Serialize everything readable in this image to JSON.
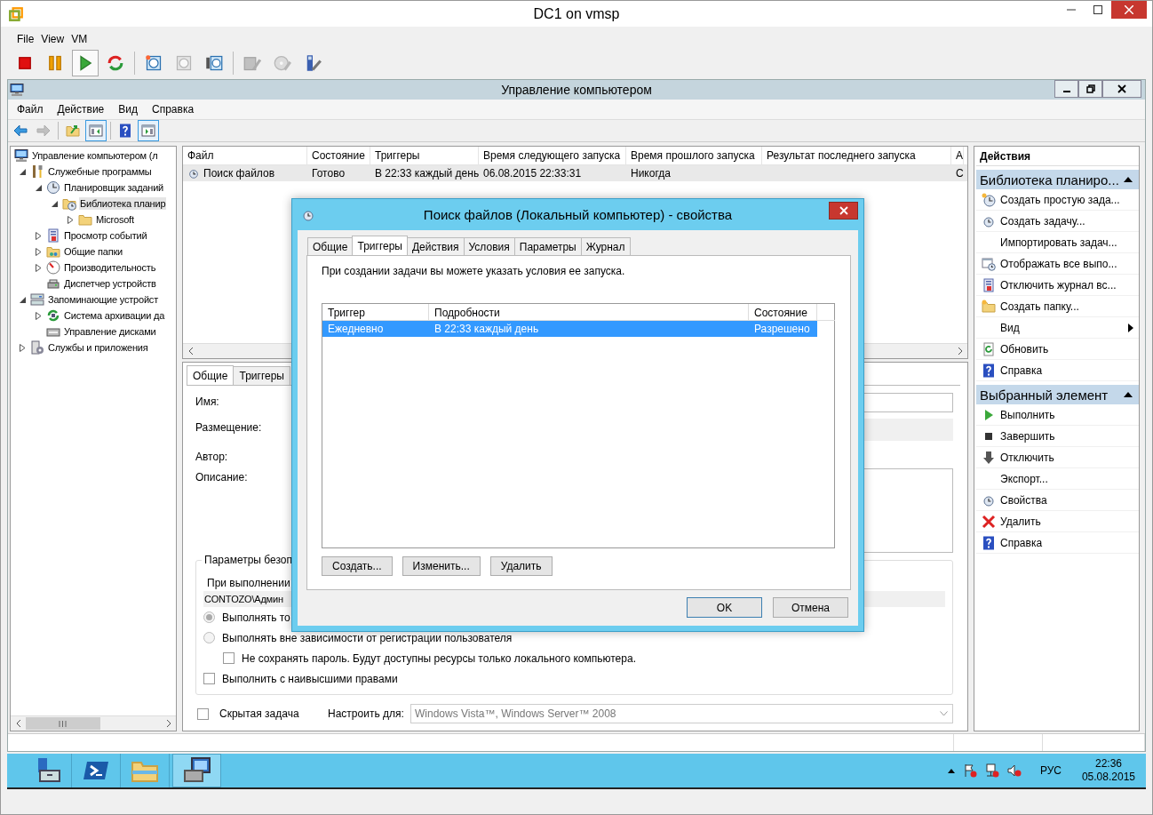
{
  "vm_window": {
    "title": "DC1 on vmsp",
    "menu": [
      "File",
      "View",
      "VM"
    ],
    "toolbar": [
      [
        {
          "kind": "stop",
          "pressed": false,
          "disabled": false
        },
        {
          "kind": "pause",
          "pressed": false,
          "disabled": false
        },
        {
          "kind": "play",
          "pressed": true,
          "disabled": false
        },
        {
          "kind": "reset",
          "pressed": false,
          "disabled": false
        }
      ],
      [
        {
          "kind": "snapshot",
          "pressed": false,
          "disabled": false
        },
        {
          "kind": "revert",
          "pressed": false,
          "disabled": true
        },
        {
          "kind": "snapshot-manager",
          "pressed": false,
          "disabled": false
        }
      ],
      [
        {
          "kind": "settings",
          "pressed": false,
          "disabled": true
        },
        {
          "kind": "disc",
          "pressed": false,
          "disabled": true
        },
        {
          "kind": "usb",
          "pressed": false,
          "disabled": false
        }
      ]
    ]
  },
  "mmc": {
    "title": "Управление компьютером",
    "menu": [
      "Файл",
      "Действие",
      "Вид",
      "Справка"
    ],
    "toolbar": [
      [
        {
          "kind": "back",
          "pressed": false,
          "disabled": false
        },
        {
          "kind": "forward",
          "pressed": false,
          "disabled": true
        }
      ],
      [
        {
          "kind": "folder-up",
          "pressed": false,
          "disabled": false
        },
        {
          "kind": "tree-pane",
          "pressed": true,
          "disabled": false
        }
      ],
      [
        {
          "kind": "help",
          "pressed": false,
          "disabled": false
        },
        {
          "kind": "action-pane",
          "pressed": true,
          "disabled": false
        }
      ]
    ]
  },
  "tree": [
    {
      "label": "Управление компьютером (л",
      "kind": "computer",
      "selected": false,
      "children": [
        {
          "label": "Служебные программы",
          "kind": "tools",
          "expanded": true,
          "selected": false,
          "children": [
            {
              "label": "Планировщик заданий",
              "kind": "clock",
              "expanded": true,
              "selected": false,
              "children": [
                {
                  "label": "Библиотека планир",
                  "kind": "folder-clock",
                  "expanded": true,
                  "selected": true,
                  "children": [
                    {
                      "label": "Microsoft",
                      "kind": "folder",
                      "expanded": false,
                      "selected": false
                    }
                  ]
                }
              ]
            },
            {
              "label": "Просмотр событий",
              "kind": "event-log",
              "expanded": false,
              "selected": false
            },
            {
              "label": "Общие папки",
              "kind": "shared-folder",
              "expanded": false,
              "selected": false
            },
            {
              "label": "Производительность",
              "kind": "gauge",
              "expanded": false,
              "selected": false
            },
            {
              "label": "Диспетчер устройств",
              "kind": "device-manager",
              "selected": false
            }
          ]
        },
        {
          "label": "Запоминающие устройст",
          "kind": "storage",
          "expanded": true,
          "selected": false,
          "children": [
            {
              "label": "Система архивации да",
              "kind": "backup",
              "expanded": false,
              "selected": false
            },
            {
              "label": "Управление дисками",
              "kind": "disk",
              "selected": false
            }
          ]
        },
        {
          "label": "Службы и приложения",
          "kind": "services",
          "expanded": false,
          "selected": false
        }
      ]
    }
  ],
  "task_list": {
    "columns": [
      "Файл",
      "Состояние",
      "Триггеры",
      "Время следующего запуска",
      "Время прошлого запуска",
      "Результат последнего запуска",
      "А"
    ],
    "rows": [
      {
        "cells": [
          "Поиск файлов",
          "Готово",
          "В 22:33 каждый день",
          "06.08.2015 22:33:31",
          "Никогда",
          null,
          "С"
        ],
        "selected": true
      }
    ]
  },
  "details": {
    "tabs": [
      {
        "label": "Общие",
        "selected": true
      },
      {
        "label": "Триггеры",
        "selected": false
      }
    ],
    "fields": [
      {
        "label": "Имя:",
        "kind": "input"
      },
      {
        "label": "Размещение:",
        "kind": "readonly"
      },
      {
        "label": "Автор:",
        "kind": "plain"
      },
      {
        "label": "Описание:",
        "kind": "textarea"
      }
    ],
    "security": {
      "title": "Параметры безоп",
      "run_as_label": "При выполнении",
      "account": "CONTOZO\\Админ",
      "options": [
        {
          "kind": "radio",
          "label": "Выполнять то",
          "checked": true
        },
        {
          "kind": "radio",
          "label": "Выполнять вне зависимости от регистрации пользователя",
          "checked": false,
          "children": [
            {
              "kind": "checkbox",
              "label": "Не сохранять пароль. Будут доступны ресурсы только локального компьютера.",
              "checked": false
            }
          ]
        },
        {
          "kind": "checkbox",
          "label": "Выполнить с наивысшими правами",
          "checked": false
        }
      ]
    },
    "hidden": {
      "label": "Скрытая задача",
      "checked": false
    },
    "configure": {
      "label": "Настроить для:",
      "value": "Windows Vista™, Windows Server™ 2008"
    }
  },
  "actions": {
    "title": "Действия",
    "sections": [
      {
        "title": "Библиотека планиро...",
        "expanded": true,
        "items": [
          {
            "label": "Создать простую зада...",
            "kind": "new-clock",
            "submenu": false
          },
          {
            "label": "Создать задачу...",
            "kind": "clock-small",
            "submenu": false
          },
          {
            "label": "Импортировать задач...",
            "kind": "none",
            "submenu": false
          },
          {
            "label": "Отображать все выпо...",
            "kind": "window-clock",
            "submenu": false
          },
          {
            "label": "Отключить журнал вс...",
            "kind": "event-log",
            "submenu": false
          },
          {
            "label": "Создать папку...",
            "kind": "new-folder",
            "submenu": false
          },
          {
            "label": "Вид",
            "kind": "none",
            "submenu": true
          },
          {
            "label": "Обновить",
            "kind": "refresh",
            "submenu": false
          },
          {
            "label": "Справка",
            "kind": "help",
            "submenu": false
          }
        ]
      },
      {
        "title": "Выбранный элемент",
        "expanded": true,
        "items": [
          {
            "label": "Выполнить",
            "kind": "run",
            "submenu": false
          },
          {
            "label": "Завершить",
            "kind": "end",
            "submenu": false
          },
          {
            "label": "Отключить",
            "kind": "down-arrow",
            "submenu": false
          },
          {
            "label": "Экспорт...",
            "kind": "none",
            "submenu": false
          },
          {
            "label": "Свойства",
            "kind": "clock-small",
            "submenu": false
          },
          {
            "label": "Удалить",
            "kind": "delete",
            "submenu": false
          },
          {
            "label": "Справка",
            "kind": "help",
            "submenu": false
          }
        ]
      }
    ]
  },
  "dialog": {
    "title": "Поиск файлов (Локальный компьютер) - свойства",
    "tabs": [
      {
        "label": "Общие",
        "selected": false
      },
      {
        "label": "Триггеры",
        "selected": true
      },
      {
        "label": "Действия",
        "selected": false
      },
      {
        "label": "Условия",
        "selected": false
      },
      {
        "label": "Параметры",
        "selected": false
      },
      {
        "label": "Журнал",
        "selected": false
      }
    ],
    "hint": "При создании задачи вы можете указать условия ее запуска.",
    "triggers": {
      "columns": [
        "Триггер",
        "Подробности",
        "Состояние"
      ],
      "rows": [
        {
          "cells": [
            "Ежедневно",
            "В 22:33 каждый день",
            "Разрешено"
          ],
          "selected": true
        }
      ]
    },
    "buttons": [
      "Создать...",
      "Изменить...",
      "Удалить"
    ],
    "footer_buttons": [
      {
        "label": "OK",
        "default": true
      },
      {
        "label": "Отмена",
        "default": false
      }
    ]
  },
  "taskbar": {
    "apps": [
      {
        "kind": "server-manager",
        "selected": false
      },
      {
        "kind": "powershell",
        "selected": false
      },
      {
        "kind": "explorer",
        "selected": false
      },
      {
        "kind": "vm-connect",
        "selected": true
      }
    ],
    "language": "РУС",
    "time": "22:36",
    "date": "05.08.2015"
  }
}
